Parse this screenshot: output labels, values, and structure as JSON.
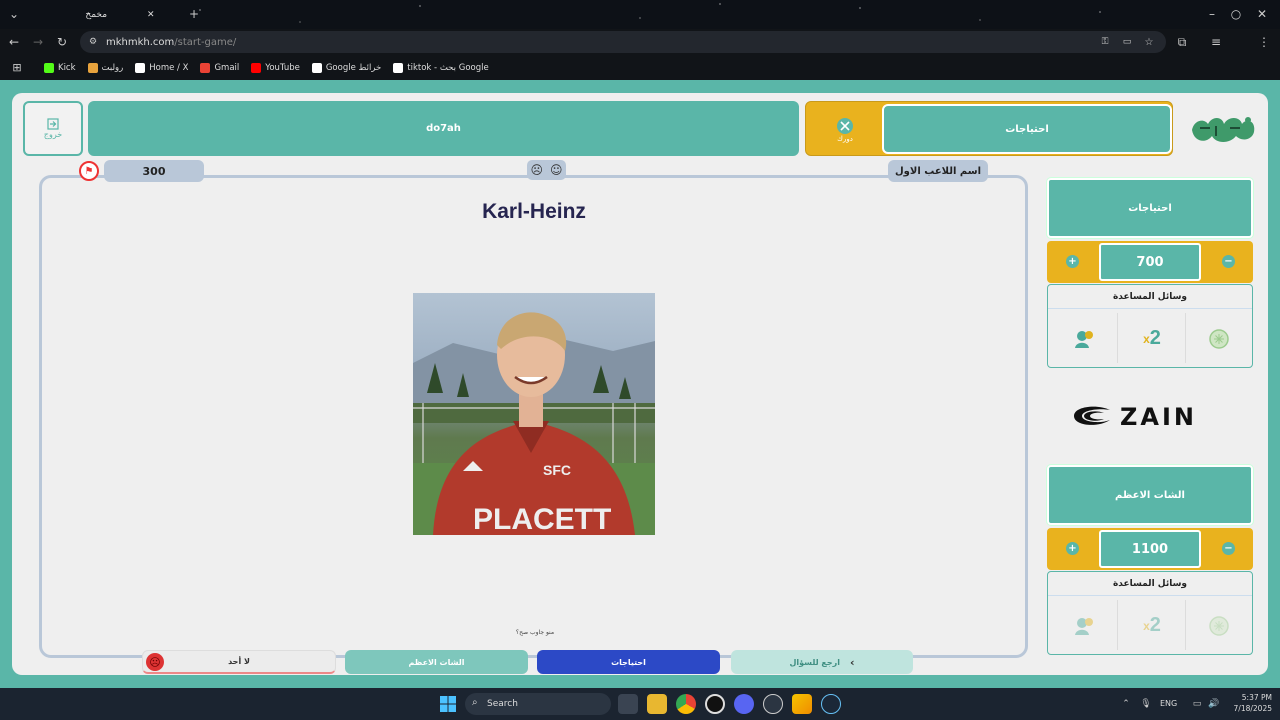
{
  "browser": {
    "tab_title": "مخمخ",
    "url_host": "mkhmkh.com",
    "url_path": "/start-game/",
    "bookmarks": [
      {
        "label": "Kick",
        "color": "#53fc18"
      },
      {
        "label": "رولبت",
        "color": "#e8a33d"
      },
      {
        "label": "Home / X",
        "color": "#ffffff"
      },
      {
        "label": "Gmail",
        "color": "#ea4335"
      },
      {
        "label": "YouTube",
        "color": "#ff0000"
      },
      {
        "label": "Google خرائط",
        "color": "#ffffff"
      },
      {
        "label": "tiktok - بحث Google",
        "color": "#ffffff"
      }
    ]
  },
  "header": {
    "exit_label": "خروج",
    "team2_name": "do7ah",
    "team1_name": "احتياجات",
    "turn_label": "دورك"
  },
  "board": {
    "score": "300",
    "player_label": "اسم اللاعب الاول",
    "answer": "Karl-Heinz",
    "question": "منو جاوب صح؟"
  },
  "bottom_buttons": {
    "none": "لا أحد",
    "team2": "الشات الاعظم",
    "team1": "احتياجات",
    "back": "ارجع للسؤال"
  },
  "team1_panel": {
    "name": "احتياجات",
    "score": "700",
    "aids_title": "وسائل المساعدة"
  },
  "team2_panel": {
    "name": "الشات الاعظم",
    "score": "1100",
    "aids_title": "وسائل المساعدة"
  },
  "sponsor": "ZAIN",
  "taskbar": {
    "search_placeholder": "Search",
    "lang": "ENG",
    "time": "5:37 PM",
    "date": "7/18/2025"
  },
  "colors": {
    "teal": "#5ab6a8",
    "yellow": "#e9b21e",
    "blue": "#2c49c6",
    "title": "#262550"
  }
}
